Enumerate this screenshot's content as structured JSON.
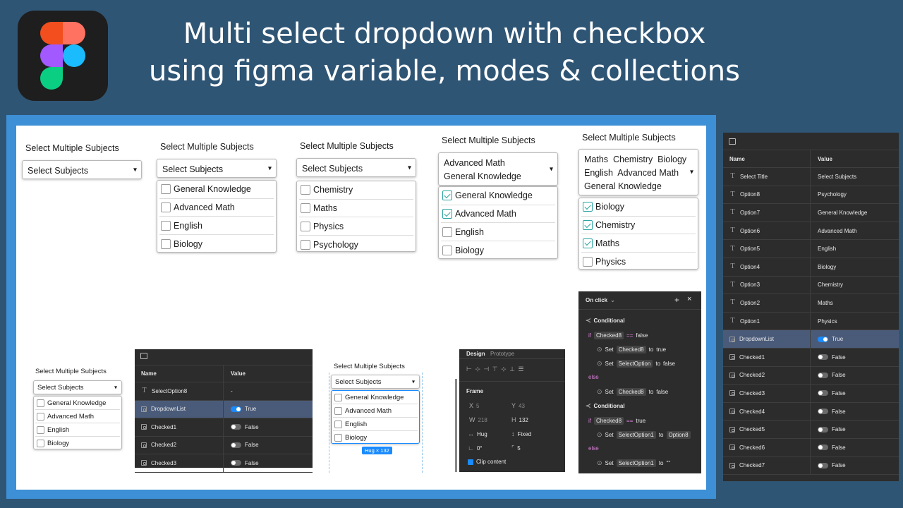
{
  "headline": {
    "line1": "Multi select dropdown with checkbox",
    "line2": "using figma variable, modes & collections"
  },
  "logo": {
    "name": "figma-logo",
    "colors": [
      "#f24e1e",
      "#ff7262",
      "#a259ff",
      "#1abcfe",
      "#0acf83"
    ]
  },
  "title": "Select Multiple Subjects",
  "placeholder": "Select Subjects",
  "arrow": "▾",
  "c2": {
    "items": [
      "General Knowledge",
      "Advanced Math",
      "English",
      "Biology"
    ]
  },
  "c3": {
    "items": [
      "Chemistry",
      "Maths",
      "Physics",
      "Psychology"
    ]
  },
  "c4": {
    "selected": [
      "Advanced Math",
      "General Knowledge"
    ],
    "items": [
      {
        "label": "General Knowledge",
        "checked": true
      },
      {
        "label": "Advanced Math",
        "checked": true
      },
      {
        "label": "English",
        "checked": false
      },
      {
        "label": "Biology",
        "checked": false
      }
    ]
  },
  "c5": {
    "selected_line1": "Maths  Chemistry  Biology",
    "selected_line2": "English  Advanced Math",
    "selected_line3": "General Knowledge",
    "items": [
      {
        "label": "Biology",
        "checked": true
      },
      {
        "label": "Chemistry",
        "checked": true
      },
      {
        "label": "Maths",
        "checked": true
      },
      {
        "label": "Physics",
        "checked": false
      }
    ]
  },
  "varpanel": {
    "header": {
      "name": "Name",
      "value": "Value"
    },
    "rows": [
      {
        "name": "SelectOption8",
        "type": "text",
        "value": "-"
      },
      {
        "name": "DropdownList",
        "type": "bool",
        "value": "True",
        "on": true,
        "highlight": true
      },
      {
        "name": "Checked1",
        "type": "bool",
        "value": "False",
        "on": false
      },
      {
        "name": "Checked2",
        "type": "bool",
        "value": "False",
        "on": false
      },
      {
        "name": "Checked3",
        "type": "bool",
        "value": "False",
        "on": false
      }
    ]
  },
  "hug": {
    "badge": "Hug × 132"
  },
  "design": {
    "tab_design": "Design",
    "tab_prototype": "Prototype",
    "frame": "Frame",
    "x_label": "X",
    "x": "5",
    "y_label": "Y",
    "y": "43",
    "w_label": "W",
    "w": "218",
    "h_label": "H",
    "h": "132",
    "hug": "Hug",
    "fixed": "Fixed",
    "rot": "0°",
    "radius": "5",
    "clip": "Clip content"
  },
  "proto": {
    "trigger": "On click",
    "conditional": "Conditional",
    "if": "if",
    "else": "else",
    "set": "Set",
    "to": "to",
    "eq": "==",
    "c1_var": "Checked8",
    "c1_val": "false",
    "a1_var": "Checked8",
    "a1_to": "true",
    "a2_var": "SelectOption",
    "a2_to": "false",
    "a3_var": "Checked8",
    "a3_to": "false",
    "c2_var": "Checked8",
    "c2_val": "true",
    "a4_var": "SelectOption1",
    "a4_to": "Option8",
    "a5_var": "SelectOption1",
    "a5_to": "\"\""
  },
  "rightpanel": {
    "header": {
      "name": "Name",
      "value": "Value"
    },
    "rows": [
      {
        "name": "Select Title",
        "type": "text",
        "value": "Select Subjects"
      },
      {
        "name": "Option8",
        "type": "text",
        "value": "Psychology"
      },
      {
        "name": "Option7",
        "type": "text",
        "value": "General Knowledge"
      },
      {
        "name": "Option6",
        "type": "text",
        "value": "Advanced Math"
      },
      {
        "name": "Option5",
        "type": "text",
        "value": "English"
      },
      {
        "name": "Option4",
        "type": "text",
        "value": "Biology"
      },
      {
        "name": "Option3",
        "type": "text",
        "value": "Chemistry"
      },
      {
        "name": "Option2",
        "type": "text",
        "value": "Maths"
      },
      {
        "name": "Option1",
        "type": "text",
        "value": "Physics"
      },
      {
        "name": "DropdownList",
        "type": "bool",
        "value": "True",
        "on": true,
        "highlight": true
      },
      {
        "name": "Checked1",
        "type": "bool",
        "value": "False",
        "on": false
      },
      {
        "name": "Checked2",
        "type": "bool",
        "value": "False",
        "on": false
      },
      {
        "name": "Checked3",
        "type": "bool",
        "value": "False",
        "on": false
      },
      {
        "name": "Checked4",
        "type": "bool",
        "value": "False",
        "on": false
      },
      {
        "name": "Checked5",
        "type": "bool",
        "value": "False",
        "on": false
      },
      {
        "name": "Checked6",
        "type": "bool",
        "value": "False",
        "on": false
      },
      {
        "name": "Checked7",
        "type": "bool",
        "value": "False",
        "on": false
      }
    ]
  }
}
